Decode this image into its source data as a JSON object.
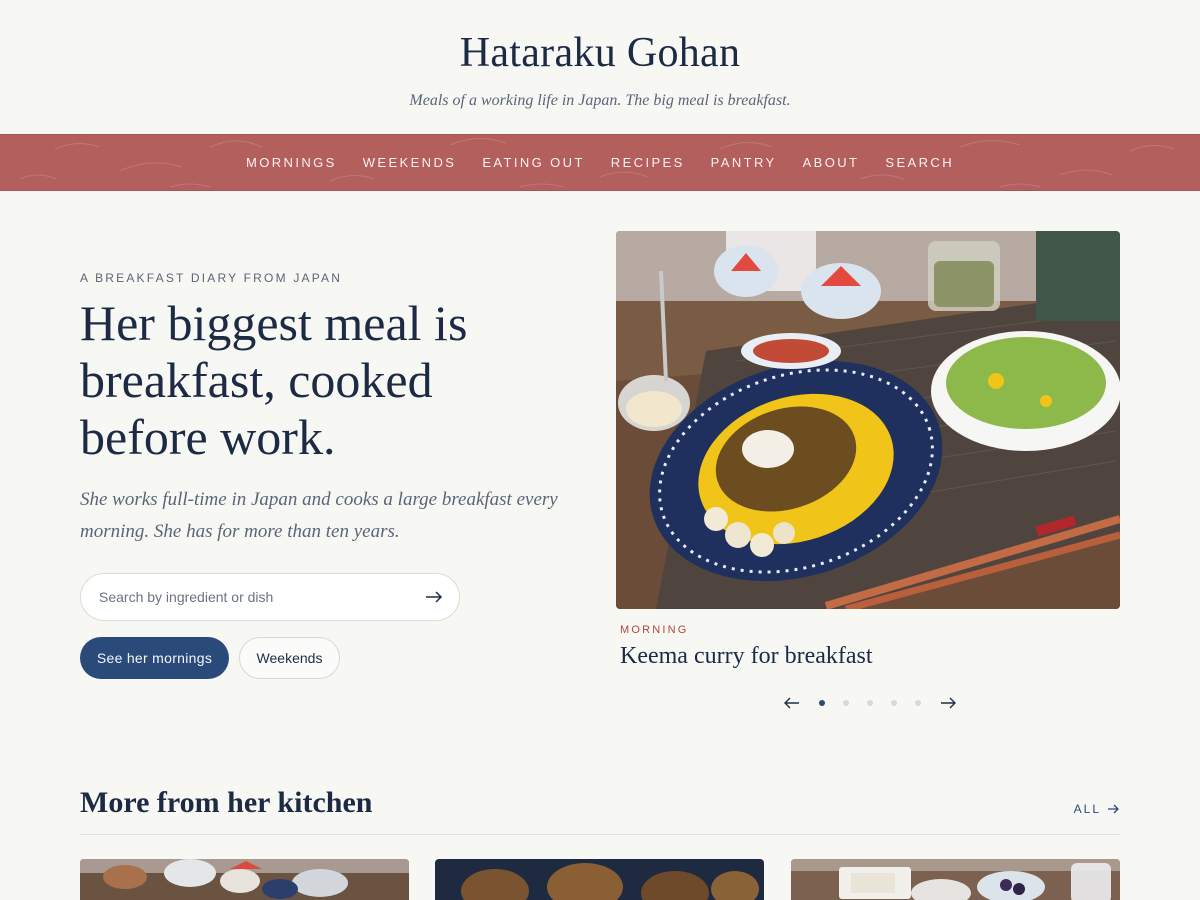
{
  "site": {
    "title": "Hataraku Gohan",
    "tagline": "Meals of a working life in Japan. The big meal is breakfast."
  },
  "nav": {
    "items": [
      {
        "label": "MORNINGS"
      },
      {
        "label": "WEEKENDS"
      },
      {
        "label": "EATING OUT"
      },
      {
        "label": "RECIPES"
      },
      {
        "label": "PANTRY"
      },
      {
        "label": "ABOUT"
      },
      {
        "label": "SEARCH"
      }
    ]
  },
  "hero": {
    "eyebrow": "A BREAKFAST DIARY FROM JAPAN",
    "heading": "Her biggest meal is breakfast, cooked before work.",
    "lede": "She works full-time in Japan and cooks a large breakfast every morning. She has for more than ten years.",
    "search": {
      "placeholder": "Search by ingredient or dish",
      "value": ""
    },
    "primary_button": "See her mornings",
    "secondary_button": "Weekends"
  },
  "feature": {
    "kicker": "MORNING",
    "title": "Keema curry for breakfast",
    "carousel": {
      "total_slides": 5,
      "active_slide": 1
    }
  },
  "more": {
    "heading": "More from her kitchen",
    "all_link": "ALL"
  },
  "icons": {
    "search_submit": "arrow-right-icon",
    "carousel_prev": "arrow-left-icon",
    "carousel_next": "arrow-right-icon",
    "all_link": "arrow-right-icon"
  },
  "colors": {
    "nav_background": "#b35f5d",
    "primary": "#2a4a7a",
    "accent": "#b0473f",
    "page_background": "#f7f7f4"
  }
}
